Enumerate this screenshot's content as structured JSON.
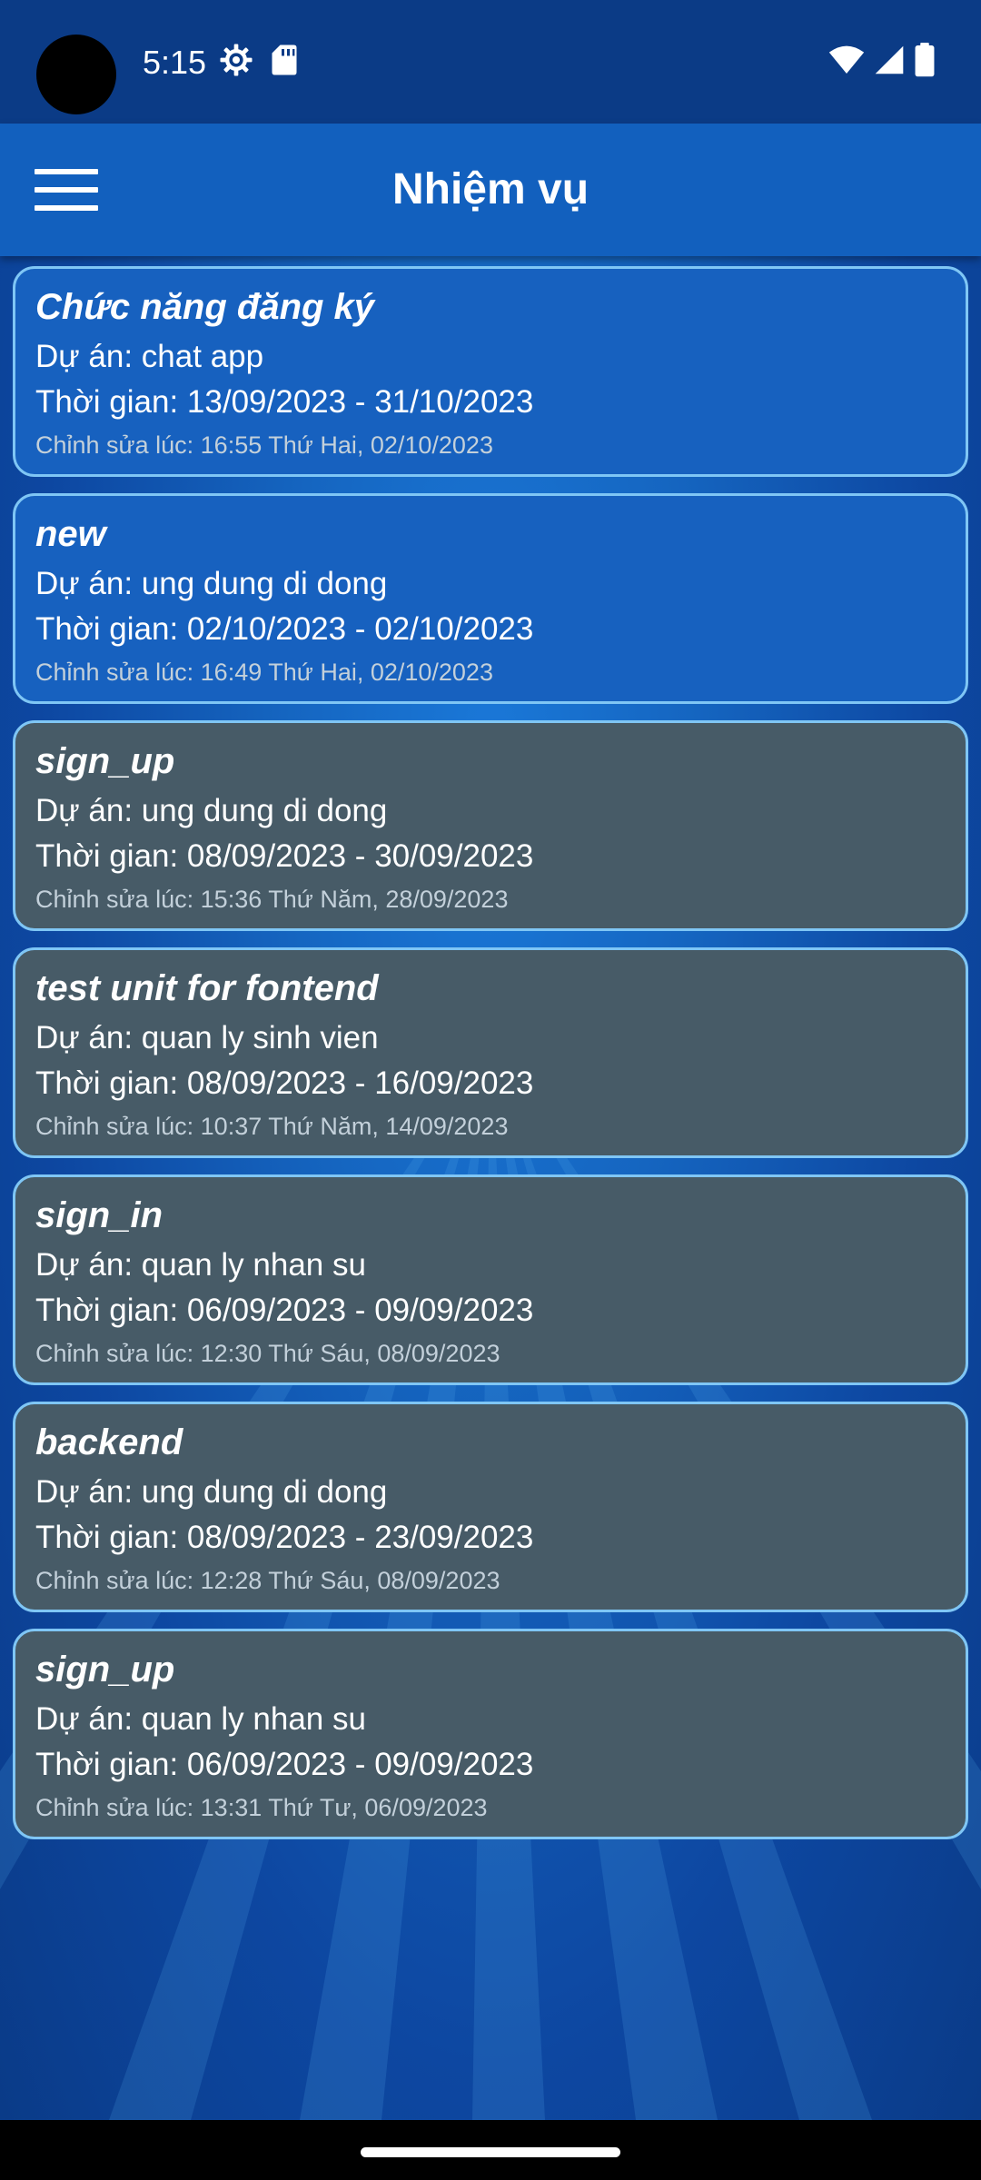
{
  "status_bar": {
    "time": "5:15",
    "icons": [
      "settings-gear-icon",
      "sd-card-icon",
      "wifi-icon",
      "signal-icon",
      "battery-icon"
    ]
  },
  "app_bar": {
    "title": "Nhiệm vụ",
    "menu_icon": "hamburger-menu-icon"
  },
  "colors": {
    "app_bar": "#1260be",
    "status_bar": "#0b3b86",
    "card_active": "#1761bf",
    "card_overdue": "#475b67",
    "card_border": "#7fc6f5"
  },
  "tasks": [
    {
      "title": "Chức năng đăng ký",
      "project": "Dự án: chat app",
      "period": "Thời gian:  13/09/2023 - 31/10/2023",
      "edited": "Chỉnh sửa lúc: 16:55 Thứ Hai, 02/10/2023",
      "state": "active"
    },
    {
      "title": "new",
      "project": "Dự án: ung dung di dong",
      "period": "Thời gian:  02/10/2023 - 02/10/2023",
      "edited": "Chỉnh sửa lúc: 16:49 Thứ Hai, 02/10/2023",
      "state": "active"
    },
    {
      "title": "sign_up",
      "project": "Dự án: ung dung di dong",
      "period": "Thời gian:  08/09/2023 - 30/09/2023",
      "edited": "Chỉnh sửa lúc: 15:36 Thứ Năm, 28/09/2023",
      "state": "overdue"
    },
    {
      "title": "test unit for fontend",
      "project": "Dự án: quan ly sinh vien",
      "period": "Thời gian:  08/09/2023 - 16/09/2023",
      "edited": "Chỉnh sửa lúc: 10:37 Thứ Năm, 14/09/2023",
      "state": "overdue"
    },
    {
      "title": "sign_in",
      "project": "Dự án: quan ly nhan su",
      "period": "Thời gian:  06/09/2023 - 09/09/2023",
      "edited": "Chỉnh sửa lúc: 12:30 Thứ Sáu, 08/09/2023",
      "state": "overdue"
    },
    {
      "title": "backend",
      "project": "Dự án: ung dung di dong",
      "period": "Thời gian:  08/09/2023 - 23/09/2023",
      "edited": "Chỉnh sửa lúc: 12:28 Thứ Sáu, 08/09/2023",
      "state": "overdue"
    },
    {
      "title": "sign_up",
      "project": "Dự án: quan ly nhan su",
      "period": "Thời gian:  06/09/2023 - 09/09/2023",
      "edited": "Chỉnh sửa lúc: 13:31 Thứ Tư, 06/09/2023",
      "state": "overdue"
    }
  ]
}
